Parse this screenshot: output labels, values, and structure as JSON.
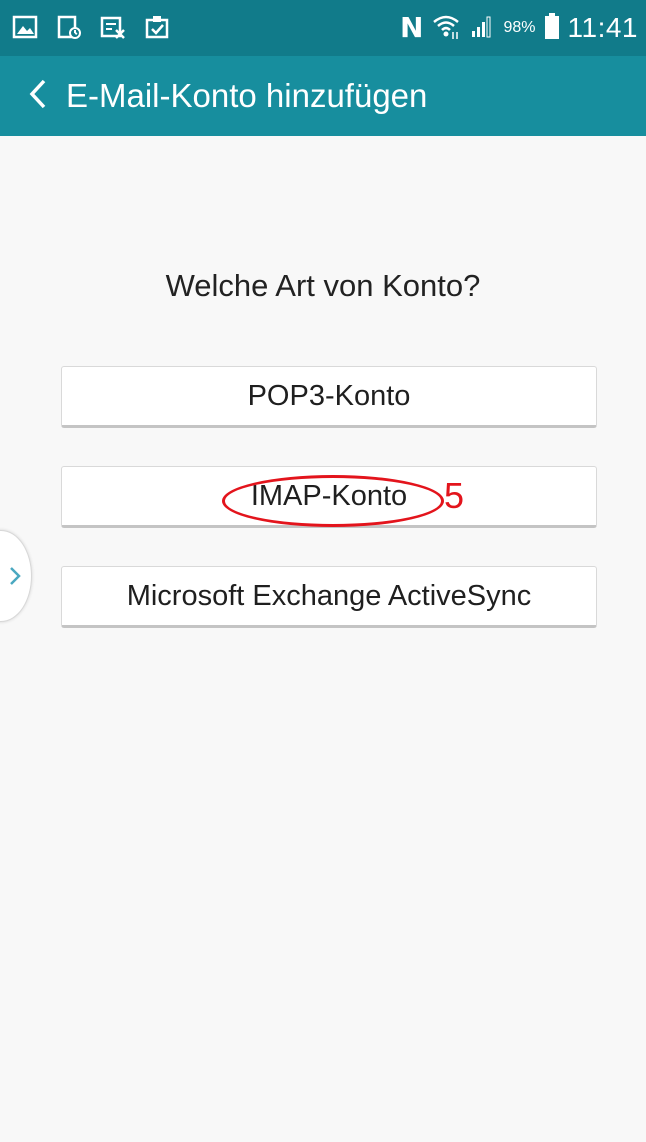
{
  "status_bar": {
    "left_icons": [
      "gallery-icon",
      "screen-cast-icon",
      "screenshot-icon",
      "clipboard-icon"
    ],
    "nfc_label": "N",
    "battery_percent": "98%",
    "time": "11:41",
    "background_color": "#117b8a"
  },
  "app_bar": {
    "title": "E-Mail-Konto hinzufügen",
    "back_icon": "chevron-left-icon",
    "background_color": "#178e9e"
  },
  "main": {
    "question": "Welche Art von Konto?",
    "options": [
      {
        "label": "POP3-Konto"
      },
      {
        "label": "IMAP-Konto"
      },
      {
        "label": "Microsoft Exchange ActiveSync"
      }
    ]
  },
  "annotation": {
    "number": "5",
    "color": "#e3141c"
  },
  "edge_tab": {
    "icon": "chevron-right-icon"
  }
}
